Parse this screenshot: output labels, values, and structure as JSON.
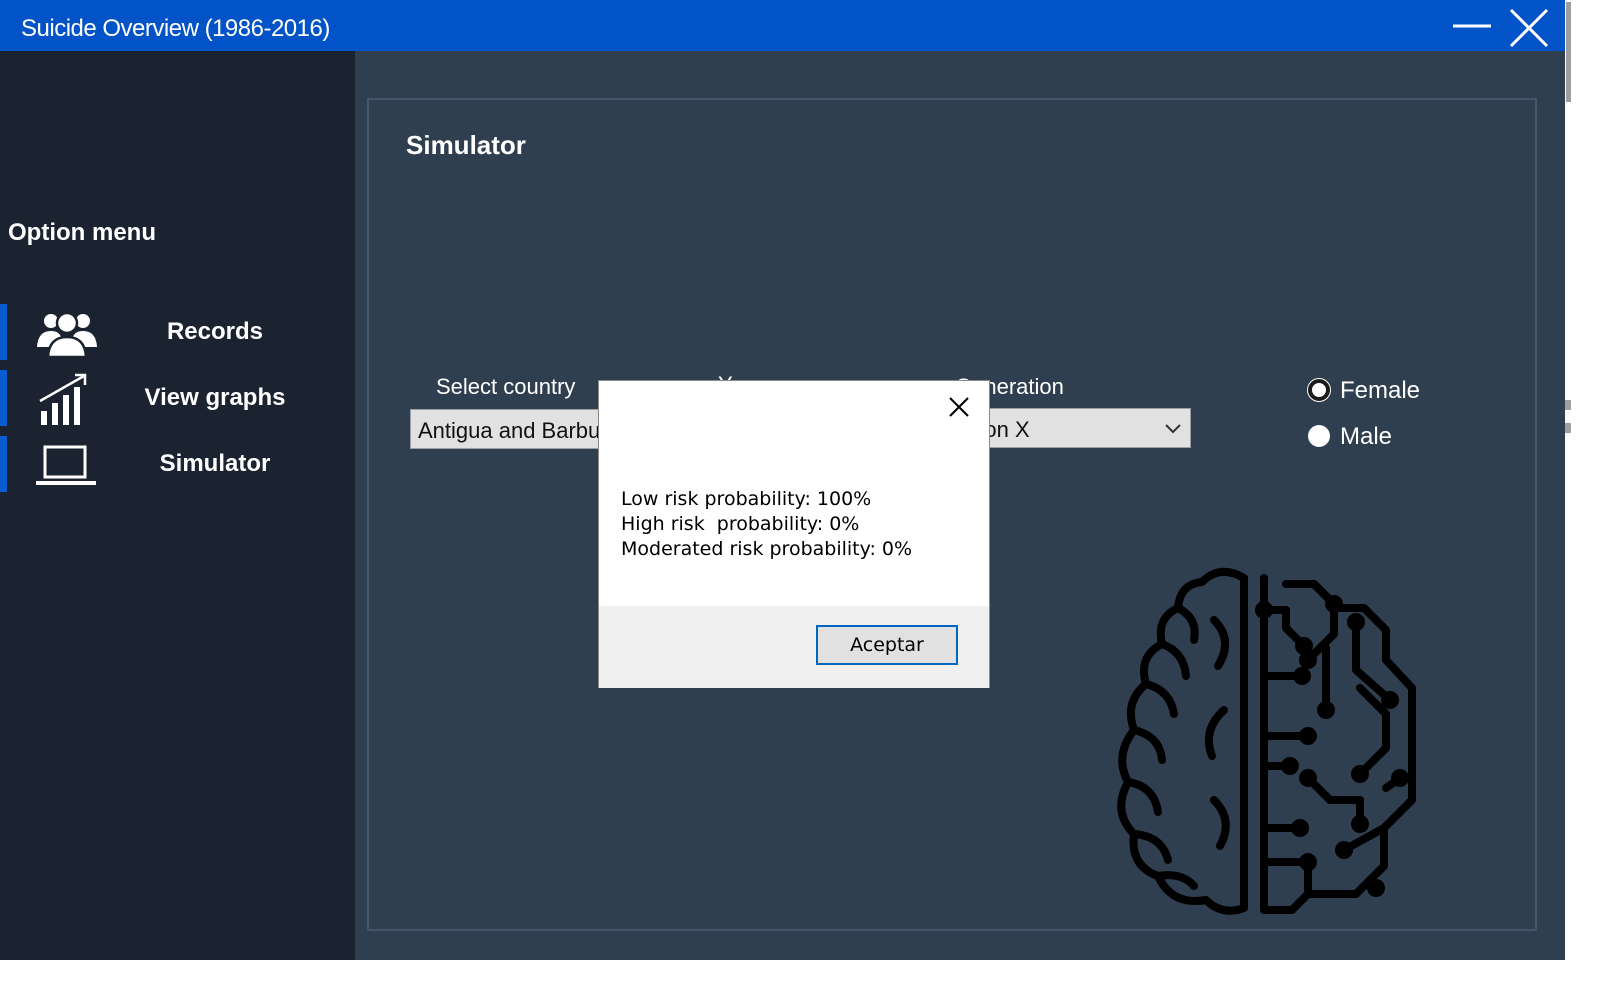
{
  "window": {
    "title": "Suicide Overview (1986-2016)"
  },
  "sidebar": {
    "menu_title": "Option menu",
    "items": [
      {
        "label": "Records",
        "icon": "users-icon"
      },
      {
        "label": "View graphs",
        "icon": "bar-chart-icon"
      },
      {
        "label": "Simulator",
        "icon": "laptop-icon"
      }
    ],
    "accent_color": "#0b5bd3"
  },
  "simulator": {
    "title": "Simulator",
    "country_label": "Select country",
    "country_value": "Antigua and Barbuda",
    "year_label": "Year",
    "generation_label": "Generation",
    "generation_value": "Generation X",
    "gender_options": [
      {
        "label": "Female",
        "checked": true
      },
      {
        "label": "Male",
        "checked": false
      }
    ],
    "illustration_icon": "brain-circuit-icon"
  },
  "dialog": {
    "lines": [
      "Low risk probability: 100%",
      "High risk  probability: 0%",
      "Moderated risk probability: 0%"
    ],
    "ok_label": "Aceptar"
  },
  "colors": {
    "titlebar": "#0153c7",
    "sidebar_bg": "#1b2330",
    "content_bg": "#303f50"
  }
}
